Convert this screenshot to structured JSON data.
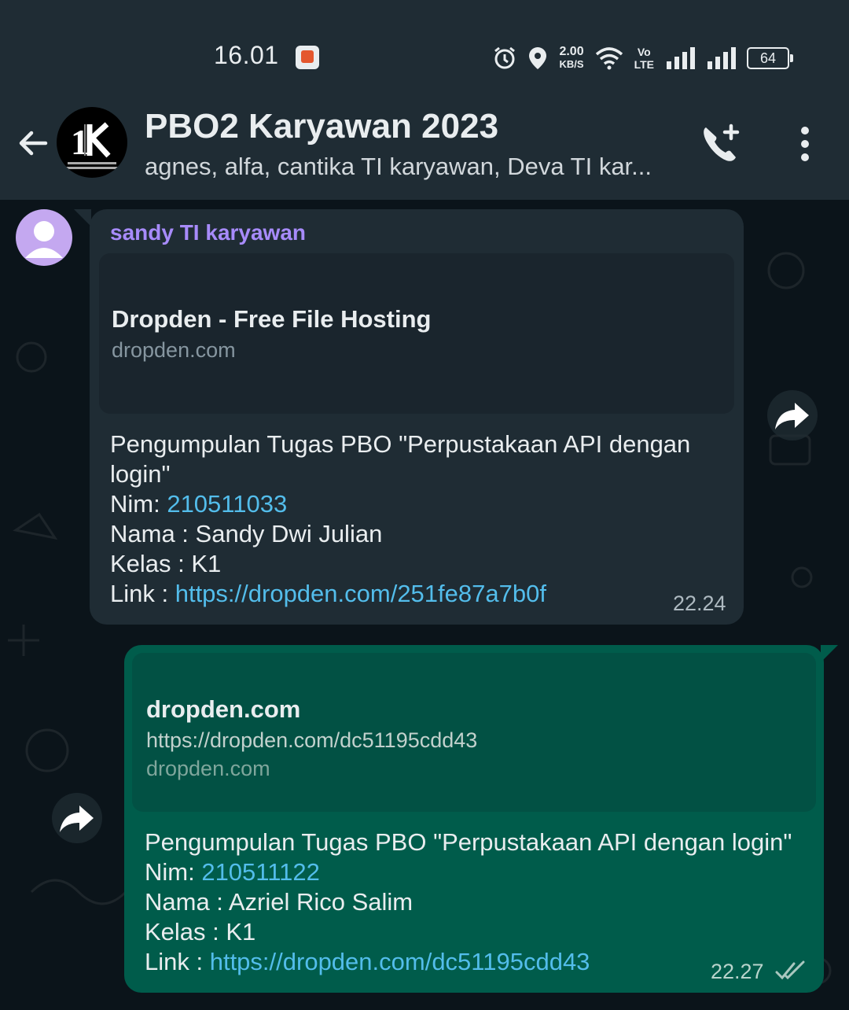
{
  "status_bar": {
    "time": "16.01",
    "net_speed_value": "2.00",
    "net_speed_unit": "KB/S",
    "volte_top": "Vo",
    "volte_bottom": "LTE",
    "battery": "64"
  },
  "header": {
    "group_name": "PBO2 Karyawan 2023",
    "members": "agnes, alfa, cantika TI karyawan, Deva TI kar..."
  },
  "messages": {
    "incoming": {
      "sender": "sandy TI karyawan",
      "preview_title": "Dropden - Free File Hosting",
      "preview_domain": "dropden.com",
      "line1": "Pengumpulan Tugas PBO \"Perpustakaan API dengan",
      "line2": "login\"",
      "nim_label": "Nim: ",
      "nim_value": "210511033",
      "nama": "Nama : Sandy Dwi Julian",
      "kelas": "Kelas : K1",
      "link_label": "Link : ",
      "link_value": "https://dropden.com/251fe87a7b0f",
      "time": "22.24"
    },
    "outgoing": {
      "preview_title": "dropden.com",
      "preview_url": "https://dropden.com/dc51195cdd43",
      "preview_domain": "dropden.com",
      "line1": "Pengumpulan Tugas PBO \"Perpustakaan API dengan login\"",
      "nim_label": "Nim: ",
      "nim_value": "210511122",
      "nama": "Nama : Azriel Rico Salim",
      "kelas": "Kelas : K1",
      "link_label": "Link : ",
      "link_value": "https://dropden.com/dc51195cdd43",
      "time": "22.27",
      "status": "read"
    }
  },
  "colors": {
    "header_bg": "#1f2c34",
    "chat_bg": "#0b141a",
    "incoming_bubble": "#1f2c34",
    "outgoing_bubble": "#005c4b",
    "sender_name": "#a78bfa",
    "link": "#53bdeb"
  }
}
